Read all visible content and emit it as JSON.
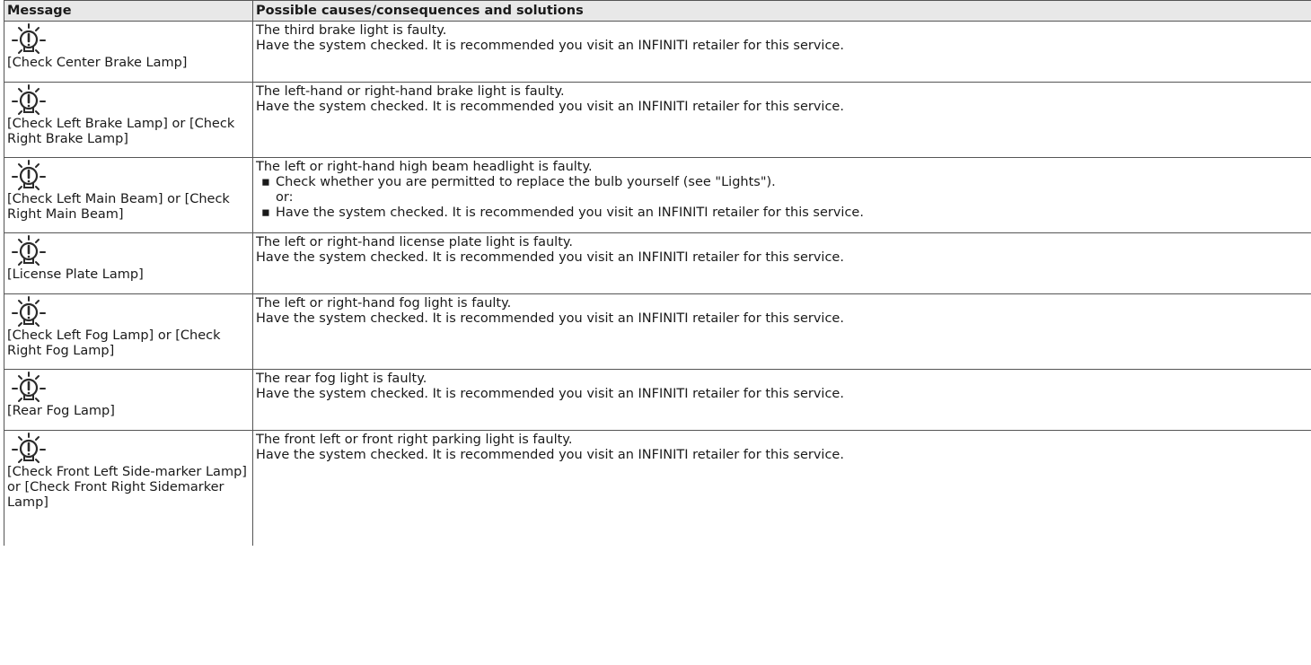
{
  "header": {
    "col1": "Message",
    "col2": "Possible causes/consequences and solutions"
  },
  "icon": "lamp-warning-icon",
  "rows": [
    {
      "message": "[Check Center Brake Lamp]",
      "lines": [
        "The third brake light is faulty.",
        "Have the system checked. It is recommended you visit an INFINITI retailer for this service."
      ]
    },
    {
      "message": "[Check Left Brake Lamp] or [Check Right Brake Lamp]",
      "lines": [
        "The left-hand or right-hand brake light is faulty.",
        "Have the system checked. It is recommended you visit an INFINITI retailer for this service."
      ]
    },
    {
      "message": "[Check Left Main Beam] or [Check Right Main Beam]",
      "intro": "The left or right-hand high beam headlight is faulty.",
      "bullets": [
        "Check whether you are permitted to replace the bulb yourself (see \"Lights\").",
        "Have the system checked. It is recommended you visit an INFINITI retailer for this service."
      ],
      "or_text": "or:"
    },
    {
      "message": "[License Plate Lamp]",
      "lines": [
        "The left or right-hand license plate light is faulty.",
        "Have the system checked. It is recommended you visit an INFINITI retailer for this service."
      ]
    },
    {
      "message": "[Check Left Fog Lamp] or [Check Right Fog Lamp]",
      "lines": [
        "The left or right-hand fog light is faulty.",
        "Have the system checked. It is recommended you visit an INFINITI retailer for this service."
      ]
    },
    {
      "message": "[Rear Fog Lamp]",
      "lines": [
        "The rear fog light is faulty.",
        "Have the system checked. It is recommended you visit an INFINITI retailer for this service."
      ]
    },
    {
      "message": "[Check Front Left Side-marker Lamp] or [Check Front Right Sidemarker Lamp]",
      "lines": [
        "The front left or front right parking light is faulty.",
        "Have the system checked. It is recommended you visit an INFINITI retailer for this service."
      ]
    }
  ]
}
